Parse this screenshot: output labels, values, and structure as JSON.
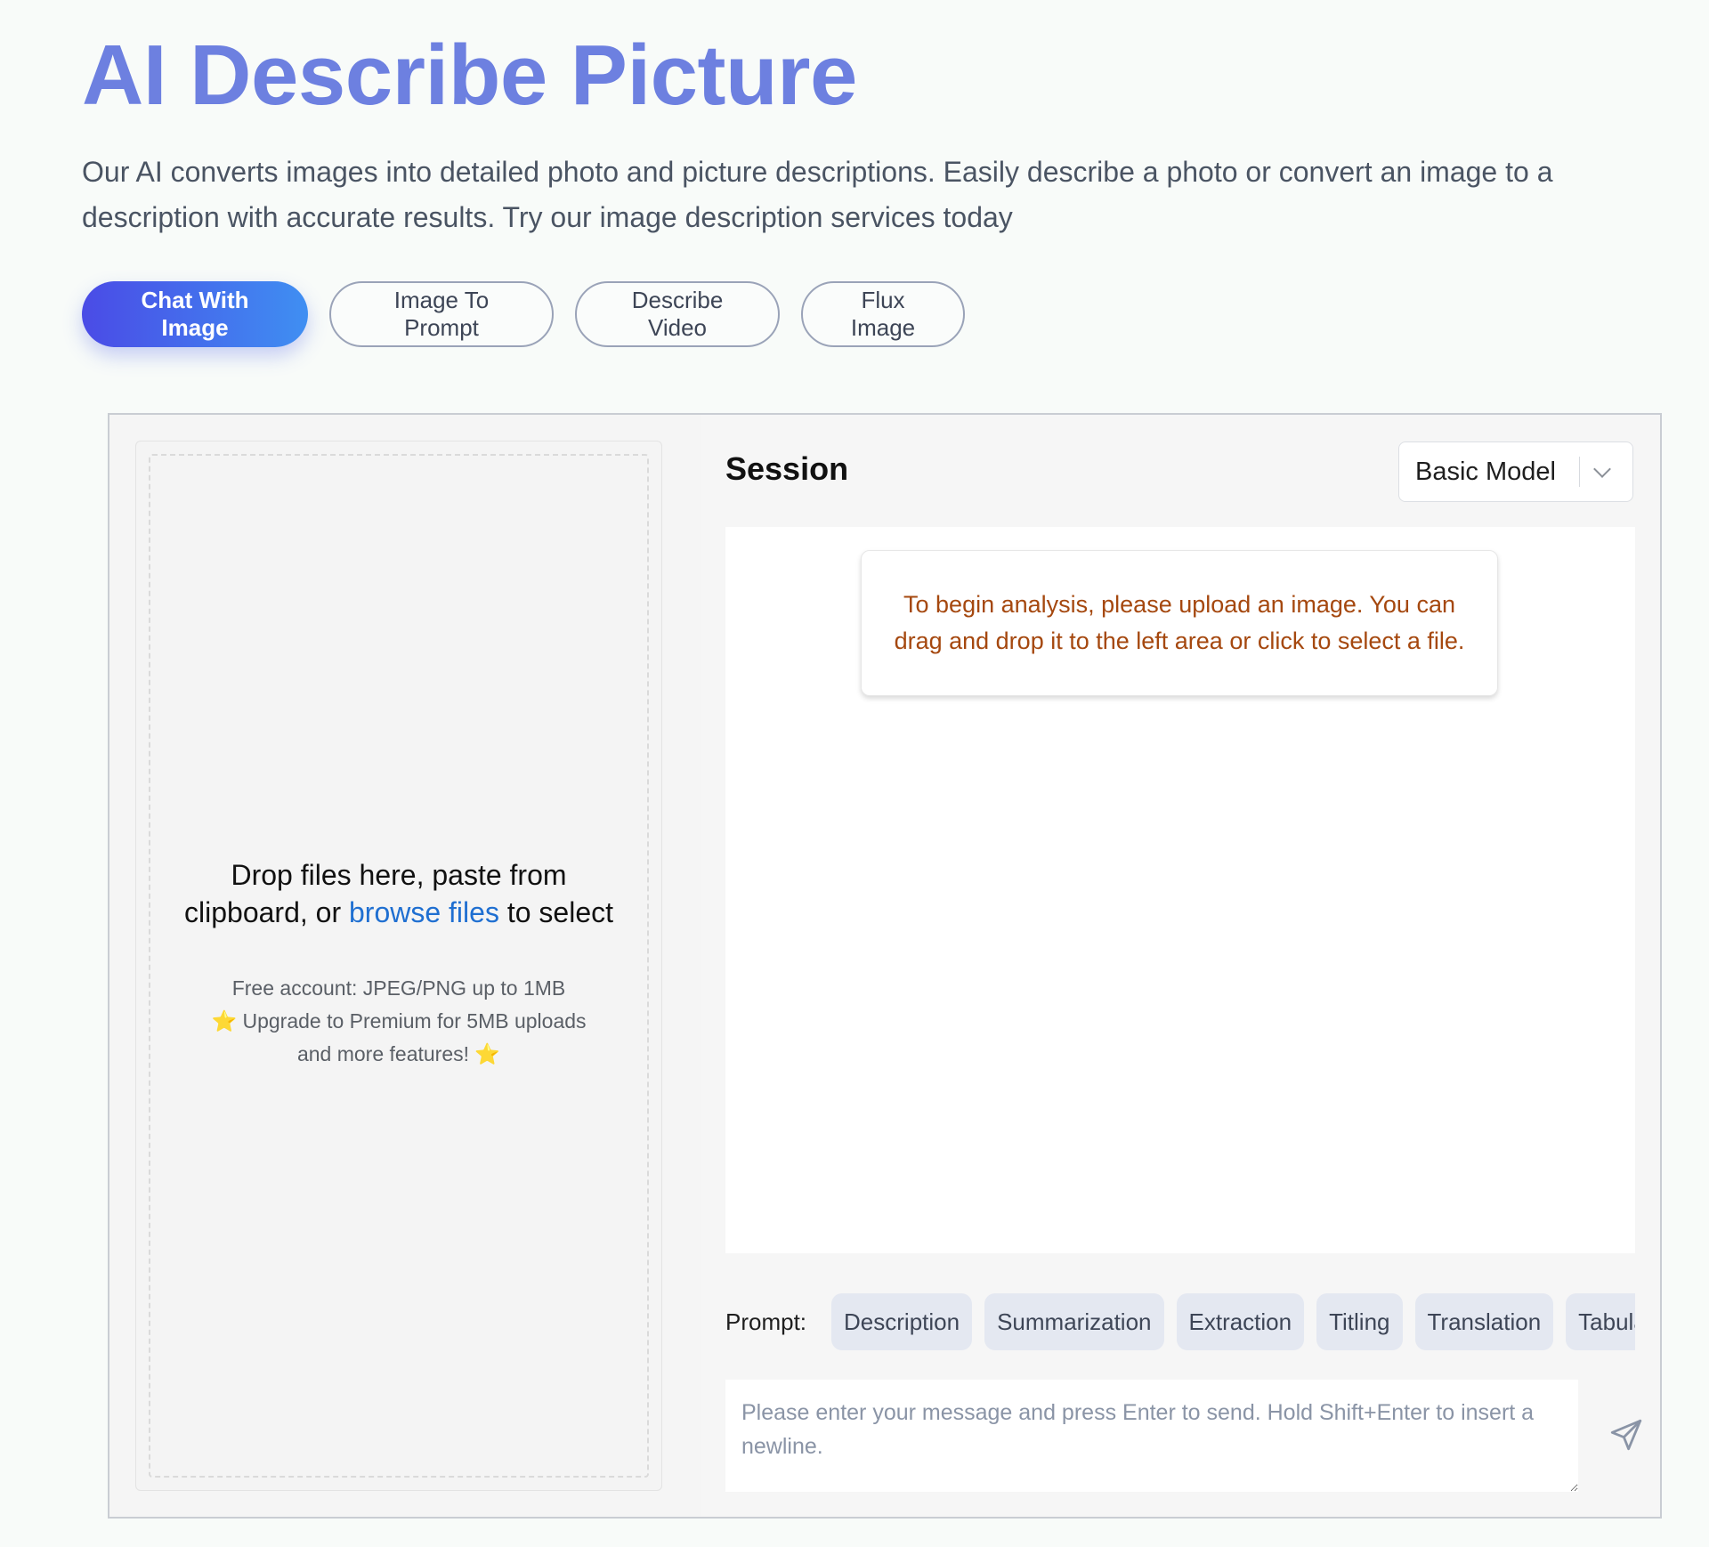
{
  "header": {
    "title": "AI Describe Picture",
    "subtitle": "Our AI converts images into detailed photo and picture descriptions. Easily describe a photo or convert an image to a description with accurate results. Try our image description services today"
  },
  "tabs": [
    {
      "label": "Chat With Image",
      "active": true
    },
    {
      "label": "Image To Prompt",
      "active": false
    },
    {
      "label": "Describe Video",
      "active": false
    },
    {
      "label": "Flux Image",
      "active": false
    }
  ],
  "upload": {
    "line1": "Drop files here, paste from",
    "line2_prefix": "clipboard, or",
    "link": "browse files",
    "line2_suffix": "to select",
    "note1": "Free account: JPEG/PNG up to 1MB",
    "note2": "Upgrade to Premium for 5MB uploads",
    "note3": "and more features!",
    "star_icon": "⭐"
  },
  "session": {
    "title": "Session",
    "model": "Basic Model",
    "info": "To begin analysis, please upload an image. You can drag and drop it to the left area or click to select a file.",
    "prompt_label": "Prompt:",
    "chips": [
      "Description",
      "Summarization",
      "Extraction",
      "Titling",
      "Translation",
      "Tabulation"
    ],
    "input_placeholder": "Please enter your message and press Enter to send. Hold Shift+Enter to insert a newline."
  },
  "colors": {
    "title": "#6d80e0",
    "accent_start": "#4a4be6",
    "accent_end": "#3f8ff2",
    "link": "#1f6fd1",
    "info_text": "#a5480f"
  },
  "icons": {
    "send": "send-icon",
    "chevron": "chevron-down-icon",
    "star": "star-icon"
  }
}
